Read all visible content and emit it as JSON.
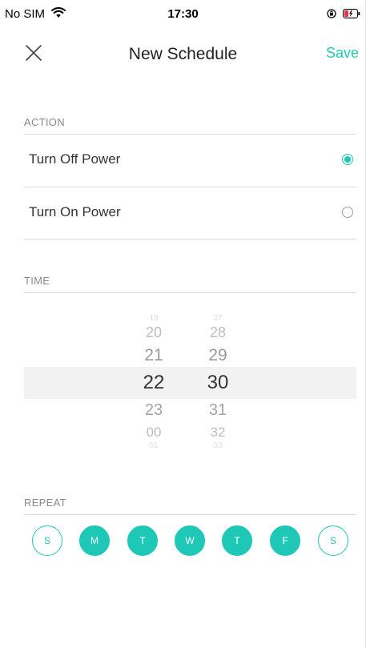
{
  "status_bar": {
    "carrier": "No SIM",
    "time": "17:30"
  },
  "nav": {
    "title": "New Schedule",
    "save_label": "Save"
  },
  "action": {
    "header": "ACTION",
    "options": [
      {
        "label": "Turn Off Power",
        "selected": true
      },
      {
        "label": "Turn On Power",
        "selected": false
      }
    ]
  },
  "time": {
    "header": "TIME",
    "hours": [
      "19",
      "20",
      "21",
      "22",
      "23",
      "00",
      "01"
    ],
    "minutes": [
      "27",
      "28",
      "29",
      "30",
      "31",
      "32",
      "33"
    ],
    "selected_hour": "22",
    "selected_minute": "30"
  },
  "repeat": {
    "header": "REPEAT",
    "days": [
      {
        "label": "S",
        "selected": false
      },
      {
        "label": "M",
        "selected": true
      },
      {
        "label": "T",
        "selected": true
      },
      {
        "label": "W",
        "selected": true
      },
      {
        "label": "T",
        "selected": true
      },
      {
        "label": "F",
        "selected": true
      },
      {
        "label": "S",
        "selected": false
      }
    ]
  },
  "colors": {
    "accent": "#1fc8b6",
    "divider": "#dcdcdc",
    "muted": "#8a8a8a"
  },
  "icons": [
    "wifi-icon",
    "orientation-lock-icon",
    "battery-charging-icon",
    "close-icon",
    "radio-selected-icon",
    "radio-unselected-icon"
  ]
}
